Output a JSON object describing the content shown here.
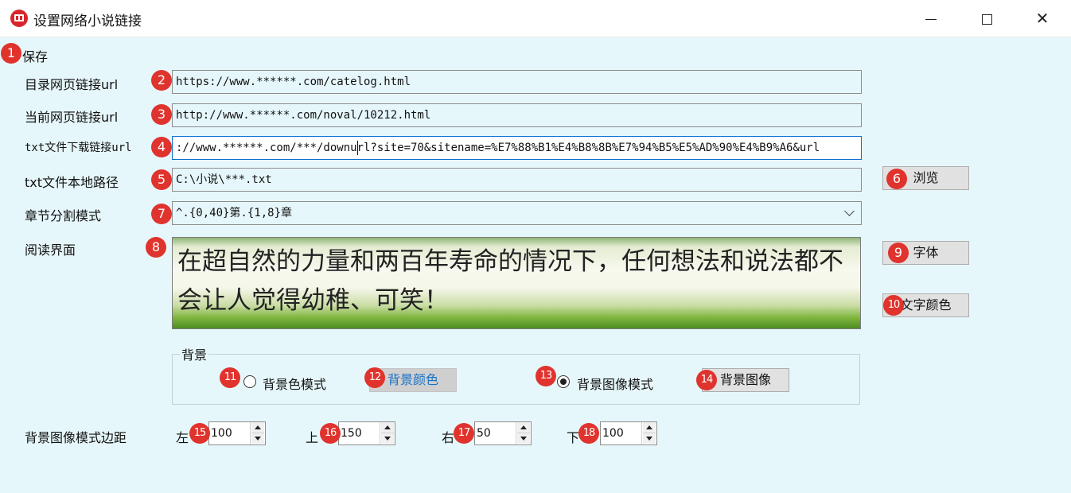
{
  "window": {
    "title": "设置网络小说链接",
    "icon": "book-app-icon"
  },
  "toolbar": {
    "save_label": "保存"
  },
  "form": {
    "catalog_url_label": "目录网页链接url",
    "catalog_url_value": "https://www.******.com/catelog.html",
    "current_url_label": "当前网页链接url",
    "current_url_value": "http://www.******.com/noval/10212.html",
    "txt_download_label": "txt文件下载链接url",
    "txt_download_value": "://www.******.com/***/downurl?site=70&sitename=%E7%88%B1%E4%B8%8B%E7%94%B5%E5%AD%90%E4%B9%A6&url",
    "txt_local_label": "txt文件本地路径",
    "txt_local_value": "C:\\小说\\***.txt",
    "browse_label": "浏览",
    "chapter_mode_label": "章节分割模式",
    "chapter_mode_value": "^.{0,40}第.{1,8}章",
    "reading_label": "阅读界面",
    "preview_text": "在超自然的力量和两百年寿命的情况下，任何想法和说法都不会让人觉得幼稚、可笑！",
    "font_button": "字体",
    "text_color_button": "文字颜色"
  },
  "background": {
    "legend": "背景",
    "color_mode_label": "背景色模式",
    "color_mode_checked": false,
    "color_button": "背景颜色",
    "image_mode_label": "背景图像模式",
    "image_mode_checked": true,
    "image_button": "背景图像"
  },
  "margins": {
    "label": "背景图像模式边距",
    "left_label": "左",
    "left_value": "100",
    "top_label": "上",
    "top_value": "150",
    "right_label": "右",
    "right_value": "50",
    "bottom_label": "下",
    "bottom_value": "100"
  },
  "markers": [
    "1",
    "2",
    "3",
    "4",
    "5",
    "6",
    "7",
    "8",
    "9",
    "10",
    "11",
    "12",
    "13",
    "14",
    "15",
    "16",
    "17",
    "18"
  ],
  "colors": {
    "background": "#e6f7fb",
    "marker": "#e0332d",
    "focus_border": "#0a6ed1",
    "pressed_button_text": "#1a72c7"
  }
}
